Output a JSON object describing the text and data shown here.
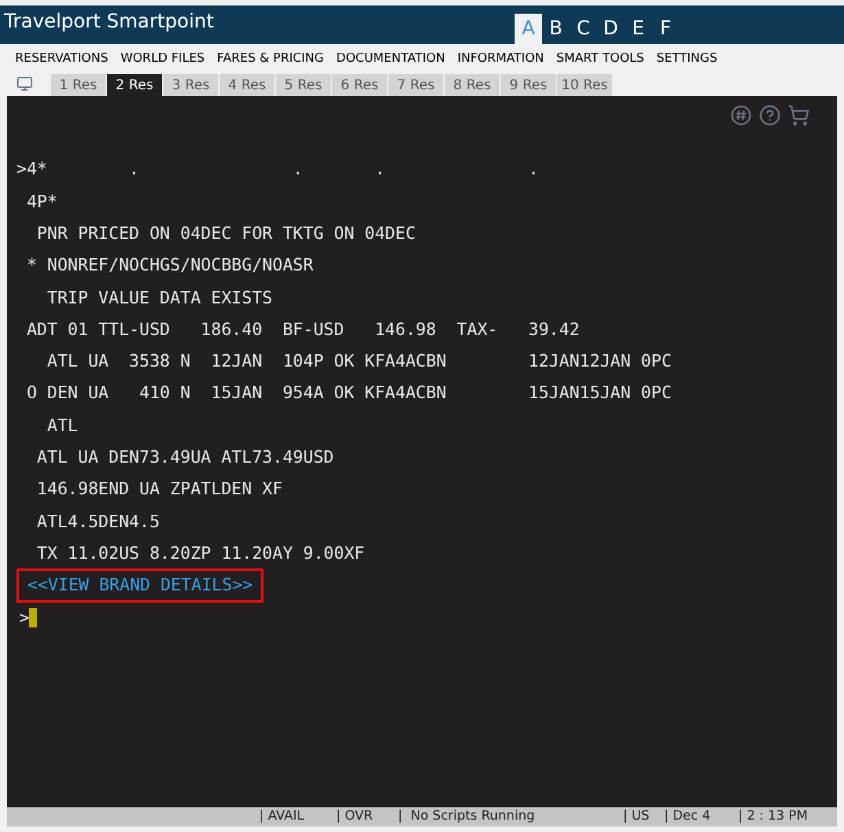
{
  "window": {
    "title": "Travelport Smartpoint"
  },
  "workspaces": [
    {
      "label": "A",
      "selected": true
    },
    {
      "label": "B",
      "selected": false
    },
    {
      "label": "C",
      "selected": false
    },
    {
      "label": "D",
      "selected": false
    },
    {
      "label": "E",
      "selected": false
    },
    {
      "label": "F",
      "selected": false
    }
  ],
  "menu": [
    "RESERVATIONS",
    "WORLD FILES",
    "FARES & PRICING",
    "DOCUMENTATION",
    "INFORMATION",
    "SMART TOOLS",
    "SETTINGS"
  ],
  "res_tabs": [
    {
      "label": "1 Res",
      "selected": false
    },
    {
      "label": "2 Res",
      "selected": true
    },
    {
      "label": "3 Res",
      "selected": false
    },
    {
      "label": "4 Res",
      "selected": false
    },
    {
      "label": "5 Res",
      "selected": false
    },
    {
      "label": "6 Res",
      "selected": false
    },
    {
      "label": "7 Res",
      "selected": false
    },
    {
      "label": "8 Res",
      "selected": false
    },
    {
      "label": "9 Res",
      "selected": false
    },
    {
      "label": "10 Res",
      "selected": false
    }
  ],
  "terminal": {
    "lines": [
      {
        "kind": "command",
        "text": ">4*        .               .       .              ."
      },
      {
        "kind": "output",
        "text": " 4P*"
      },
      {
        "kind": "output",
        "text": "  PNR PRICED ON 04DEC FOR TKTG ON 04DEC"
      },
      {
        "kind": "output",
        "text": " * NONREF/NOCHGS/NOCBBG/NOASR"
      },
      {
        "kind": "output",
        "text": "   TRIP VALUE DATA EXISTS"
      },
      {
        "kind": "output",
        "text": " ADT 01 TTL-USD   186.40  BF-USD   146.98  TAX-   39.42"
      },
      {
        "kind": "output",
        "text": "   ATL UA  3538 N  12JAN  104P OK KFA4ACBN        12JAN12JAN 0PC"
      },
      {
        "kind": "output",
        "text": " O DEN UA   410 N  15JAN  954A OK KFA4ACBN        15JAN15JAN 0PC"
      },
      {
        "kind": "output",
        "text": "   ATL"
      },
      {
        "kind": "output",
        "text": "  ATL UA DEN73.49UA ATL73.49USD"
      },
      {
        "kind": "output",
        "text": "  146.98END UA ZPATLDEN XF"
      },
      {
        "kind": "output",
        "text": "  ATL4.5DEN4.5"
      },
      {
        "kind": "output",
        "text": "  TX 11.02US 8.20ZP 11.20AY 9.00XF"
      },
      {
        "kind": "link",
        "text": "<<VIEW BRAND DETAILS>>",
        "highlighted": true
      },
      {
        "kind": "prompt",
        "text": ">"
      }
    ]
  },
  "status_bar": [
    "| AVAIL",
    "| OVR",
    "|  No Scripts Running",
    "| US",
    "| Dec 4",
    "| 2 : 13 PM"
  ]
}
